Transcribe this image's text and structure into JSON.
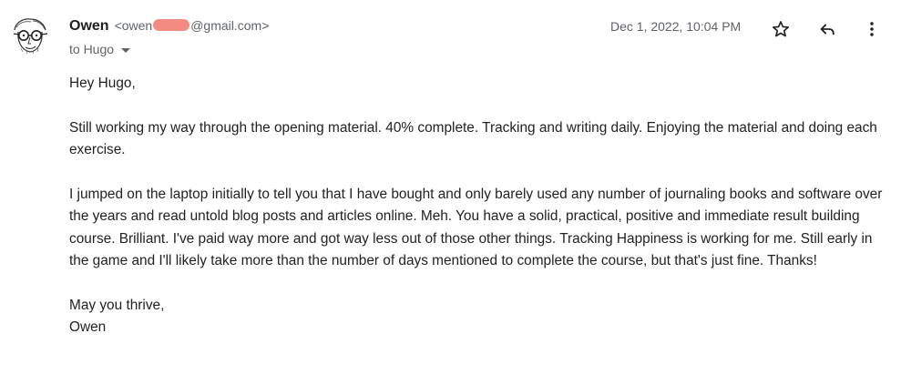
{
  "header": {
    "sender_name": "Owen",
    "sender_email_prefix": "<owen",
    "sender_email_suffix": "@gmail.com>",
    "recipient_label": "to Hugo",
    "date": "Dec 1, 2022, 10:04 PM",
    "icons": {
      "star": "star-outline-icon",
      "reply": "reply-arrow-icon",
      "more": "more-vertical-icon"
    }
  },
  "body": {
    "greeting": "Hey Hugo,",
    "paragraph1": "Still working my way through the opening material. 40% complete. Tracking and writing daily. Enjoying the material and doing each exercise.",
    "paragraph2": "I jumped on the laptop initially to tell you that I have bought and only barely used any number of journaling books and software over the years and read untold blog posts and articles online. Meh. You have a solid, practical, positive and immediate result building course. Brilliant. I've paid way more and got way less out of those other things. Tracking Happiness is working for me. Still early in the game and I'll likely take more than the number of days mentioned to complete the course, but that's just fine. Thanks!",
    "signoff": "May you thrive,",
    "signature": "Owen"
  },
  "colors": {
    "redaction": "#f28b82",
    "secondary_text": "#5f6368",
    "primary_text": "#202124"
  }
}
